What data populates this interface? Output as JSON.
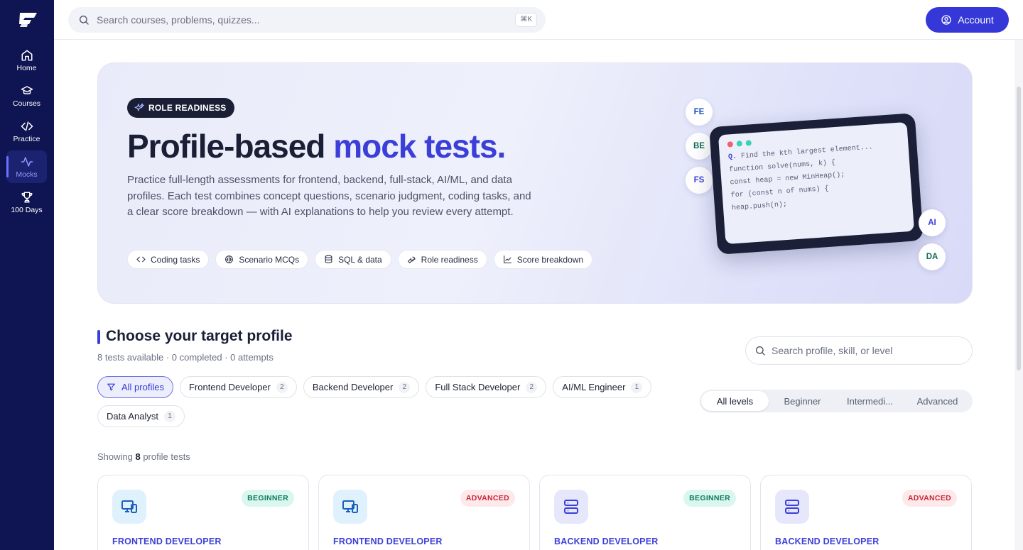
{
  "sidebar": {
    "items": [
      {
        "label": "Home",
        "icon": "home-icon"
      },
      {
        "label": "Courses",
        "icon": "graduation-cap-icon"
      },
      {
        "label": "Practice",
        "icon": "code-icon"
      },
      {
        "label": "Mocks",
        "icon": "activity-icon",
        "active": true
      },
      {
        "label": "100 Days",
        "icon": "trophy-icon"
      }
    ]
  },
  "topbar": {
    "search_placeholder": "Search courses, problems, quizzes...",
    "shortcut": "⌘K",
    "account_label": "Account"
  },
  "hero": {
    "badge": "ROLE READINESS",
    "title_plain": "Profile-based ",
    "title_accent": "mock tests.",
    "description": "Practice full-length assessments for frontend, backend, full-stack, AI/ML, and data profiles. Each test combines concept questions, scenario judgment, coding tasks, and a clear score breakdown — with AI explanations to help you review every attempt.",
    "chips": [
      {
        "label": "Coding tasks",
        "icon": "code-icon"
      },
      {
        "label": "Scenario MCQs",
        "icon": "brain-icon"
      },
      {
        "label": "SQL & data",
        "icon": "database-icon"
      },
      {
        "label": "Role readiness",
        "icon": "wrench-icon"
      },
      {
        "label": "Score breakdown",
        "icon": "line-chart-icon"
      }
    ],
    "profile_bubbles": [
      "FE",
      "BE",
      "FS",
      "AI",
      "DA"
    ],
    "code_lines": [
      "Find the kth largest element...",
      "function solve(nums, k) {",
      "const heap = new MinHeap();",
      "for (const n of nums) {",
      "heap.push(n);"
    ],
    "code_prefix": "Q."
  },
  "section": {
    "title": "Choose your target profile",
    "subtitle": "8 tests available · 0 completed · 0 attempts",
    "search_placeholder": "Search profile, skill, or level"
  },
  "filters": [
    {
      "label": "All profiles",
      "active": true
    },
    {
      "label": "Frontend Developer",
      "count": "2"
    },
    {
      "label": "Backend Developer",
      "count": "2"
    },
    {
      "label": "Full Stack Developer",
      "count": "2"
    },
    {
      "label": "AI/ML Engineer",
      "count": "1"
    },
    {
      "label": "Data Analyst",
      "count": "1"
    }
  ],
  "levels": [
    "All levels",
    "Beginner",
    "Intermedi...",
    "Advanced"
  ],
  "showing": {
    "prefix": "Showing ",
    "count": "8",
    "suffix": " profile tests"
  },
  "cards": [
    {
      "role": "FRONTEND DEVELOPER",
      "level": "BEGINNER",
      "icon": "monitor-icon"
    },
    {
      "role": "FRONTEND DEVELOPER",
      "level": "ADVANCED",
      "icon": "monitor-icon"
    },
    {
      "role": "BACKEND DEVELOPER",
      "level": "BEGINNER",
      "icon": "server-icon"
    },
    {
      "role": "BACKEND DEVELOPER",
      "level": "ADVANCED",
      "icon": "server-icon"
    }
  ],
  "colors": {
    "sidebar_bg": "#0f1452",
    "accent": "#3b3fd8",
    "beginner_bg": "#d9f7ee",
    "beginner_fg": "#0f7a5c",
    "advanced_bg": "#fde8ea",
    "advanced_fg": "#c8283a"
  }
}
